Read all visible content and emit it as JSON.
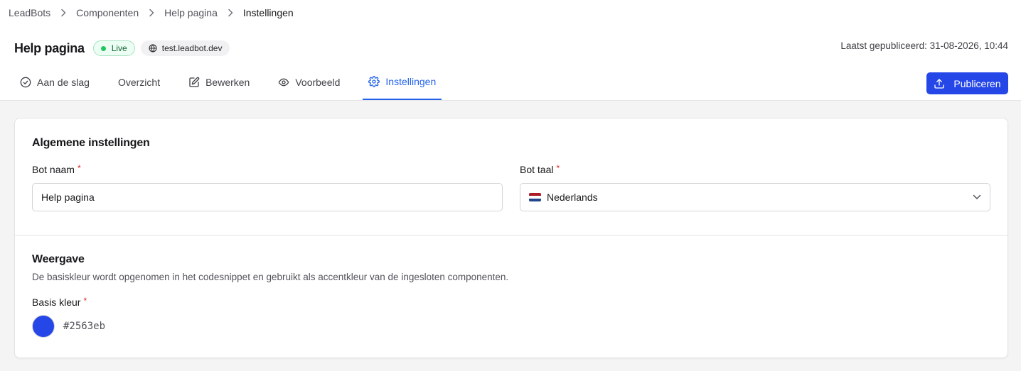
{
  "breadcrumb": [
    "LeadBots",
    "Componenten",
    "Help pagina",
    "Instellingen"
  ],
  "header": {
    "title": "Help pagina",
    "status": "Live",
    "domain": "test.leadbot.dev",
    "last_published": "Laatst gepubliceerd: 31-08-2026, 10:44"
  },
  "tabs": [
    {
      "label": "Aan de slag",
      "icon": "check-circle-icon"
    },
    {
      "label": "Overzicht",
      "icon": ""
    },
    {
      "label": "Bewerken",
      "icon": "edit-icon"
    },
    {
      "label": "Voorbeeld",
      "icon": "eye-icon"
    },
    {
      "label": "Instellingen",
      "icon": "gear-icon",
      "active": true
    }
  ],
  "publish_label": "Publiceren",
  "general": {
    "title": "Algemene instellingen",
    "bot_name_label": "Bot naam",
    "bot_name_value": "Help pagina",
    "bot_lang_label": "Bot taal",
    "bot_lang_value": "Nederlands"
  },
  "display": {
    "title": "Weergave",
    "description": "De basiskleur wordt opgenomen in het codesnippet en gebruikt als accentkleur van de ingesloten componenten.",
    "color_label": "Basis kleur",
    "color_value": "#2563eb"
  },
  "colors": {
    "accent": "#2563eb",
    "button": "#2547e8",
    "live_dot": "#22c55e",
    "required": "#dc2626"
  },
  "required_marker": "*"
}
